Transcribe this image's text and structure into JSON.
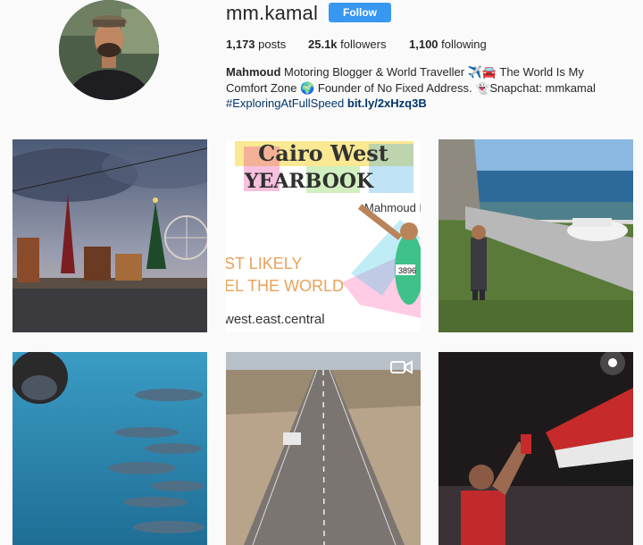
{
  "profile": {
    "username": "mm.kamal",
    "follow_label": "Follow",
    "posts_count": "1,173",
    "posts_label": "posts",
    "followers_count": "25.1k",
    "followers_label": "followers",
    "following_count": "1,100",
    "following_label": "following",
    "bio": {
      "name": "Mahmoud",
      "line1": " Motoring Blogger & World Traveller ✈️🚘 The World Is My Comfort Zone 🌍 Founder of No Fixed Address. 👻Snapchat: mmkamal",
      "hashtag": "#ExploringAtFullSpeed",
      "link": "bit.ly/2xHzq3B"
    }
  },
  "posts": [
    {
      "name": "post-christmas-market",
      "kind": "photo"
    },
    {
      "name": "post-cairo-west-yearbook",
      "kind": "photo",
      "title1": "Cairo West",
      "title2": "YEARBOOK",
      "person": "Mahmoud I",
      "line1": "ST LIKELY",
      "line2": "EL THE WORLD",
      "url": "west.east.central",
      "badge": "3896"
    },
    {
      "name": "post-coastal-road",
      "kind": "photo"
    },
    {
      "name": "post-dolphins",
      "kind": "photo"
    },
    {
      "name": "post-desert-highway",
      "kind": "video"
    },
    {
      "name": "post-night-flag",
      "kind": "photo"
    }
  ]
}
